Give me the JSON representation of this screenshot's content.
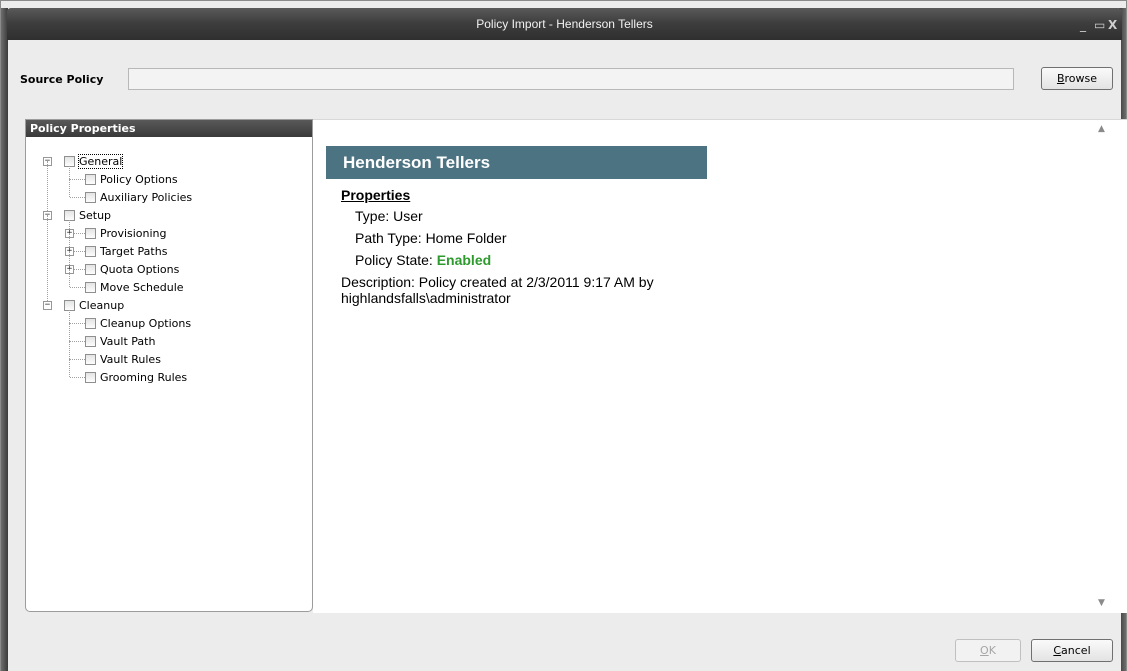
{
  "window": {
    "title": "Policy Import - Henderson Tellers",
    "minimize_glyph": "_",
    "maximize_glyph": "▭",
    "close_glyph": "X"
  },
  "source": {
    "label": "Source Policy",
    "value": "",
    "browse_label_underlined": "B",
    "browse_label_rest": "rowse"
  },
  "panel": {
    "header": "Policy Properties"
  },
  "tree": [
    {
      "label": "General",
      "level": 0,
      "expander": "minus"
    },
    {
      "label": "Policy Options",
      "level": 1,
      "expander": "none"
    },
    {
      "label": "Auxiliary Policies",
      "level": 1,
      "expander": "none"
    },
    {
      "label": "Setup",
      "level": 0,
      "expander": "minus"
    },
    {
      "label": "Provisioning",
      "level": 1,
      "expander": "plus"
    },
    {
      "label": "Target Paths",
      "level": 1,
      "expander": "plus"
    },
    {
      "label": "Quota Options",
      "level": 1,
      "expander": "plus"
    },
    {
      "label": "Move Schedule",
      "level": 1,
      "expander": "none"
    },
    {
      "label": "Cleanup",
      "level": 0,
      "expander": "minus"
    },
    {
      "label": "Cleanup Options",
      "level": 1,
      "expander": "none"
    },
    {
      "label": "Vault Path",
      "level": 1,
      "expander": "none"
    },
    {
      "label": "Vault Rules",
      "level": 1,
      "expander": "none"
    },
    {
      "label": "Grooming Rules",
      "level": 1,
      "expander": "none"
    }
  ],
  "details": {
    "banner": "Henderson Tellers",
    "properties_title": "Properties",
    "type": "Type: User",
    "path_type": "Path Type: Home Folder",
    "policy_state_label": "Policy State: ",
    "policy_state_value": "Enabled",
    "description_line1": "Description: Policy created at 2/3/2011 9:17 AM by",
    "description_line2": "highlandsfalls\\administrator"
  },
  "footer": {
    "ok_underlined": "O",
    "ok_rest": "K",
    "cancel_underlined": "C",
    "cancel_rest": "ancel"
  },
  "colors": {
    "banner": "#4b7382",
    "enabled": "#2e9a2e"
  }
}
